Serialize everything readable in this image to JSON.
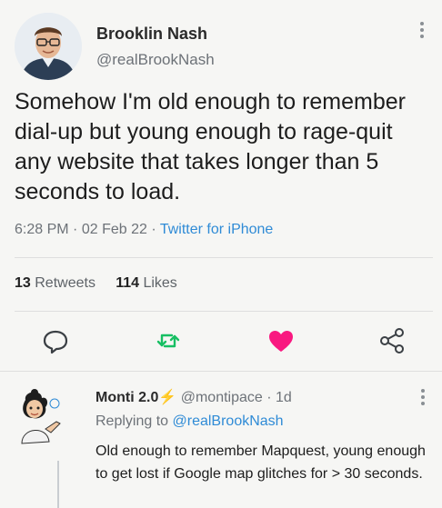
{
  "tweet": {
    "author_name": "Brooklin Nash",
    "author_handle": "@realBrookNash",
    "text": "Somehow I'm old enough to remember dial-up but young enough to rage-quit any website that takes longer than 5 seconds to load.",
    "time": "6:28 PM",
    "date": "02 Feb 22",
    "source": "Twitter for iPhone",
    "retweets_count": "13",
    "retweets_label": "Retweets",
    "likes_count": "114",
    "likes_label": "Likes"
  },
  "actions": {
    "reply_icon": "reply-icon",
    "retweet_icon": "retweet-icon",
    "like_icon": "heart-icon",
    "share_icon": "share-icon",
    "like_color": "#f91880",
    "retweet_color": "#17bf63"
  },
  "reply": {
    "author_name": "Monti 2.0",
    "author_emoji": "⚡",
    "author_handle": "@montipace",
    "age": "1d",
    "replying_prefix": "Replying to",
    "replying_to": "@realBrookNash",
    "text": "Old enough to remember Mapquest, young enough to get lost if Google map glitches for > 30 seconds."
  }
}
